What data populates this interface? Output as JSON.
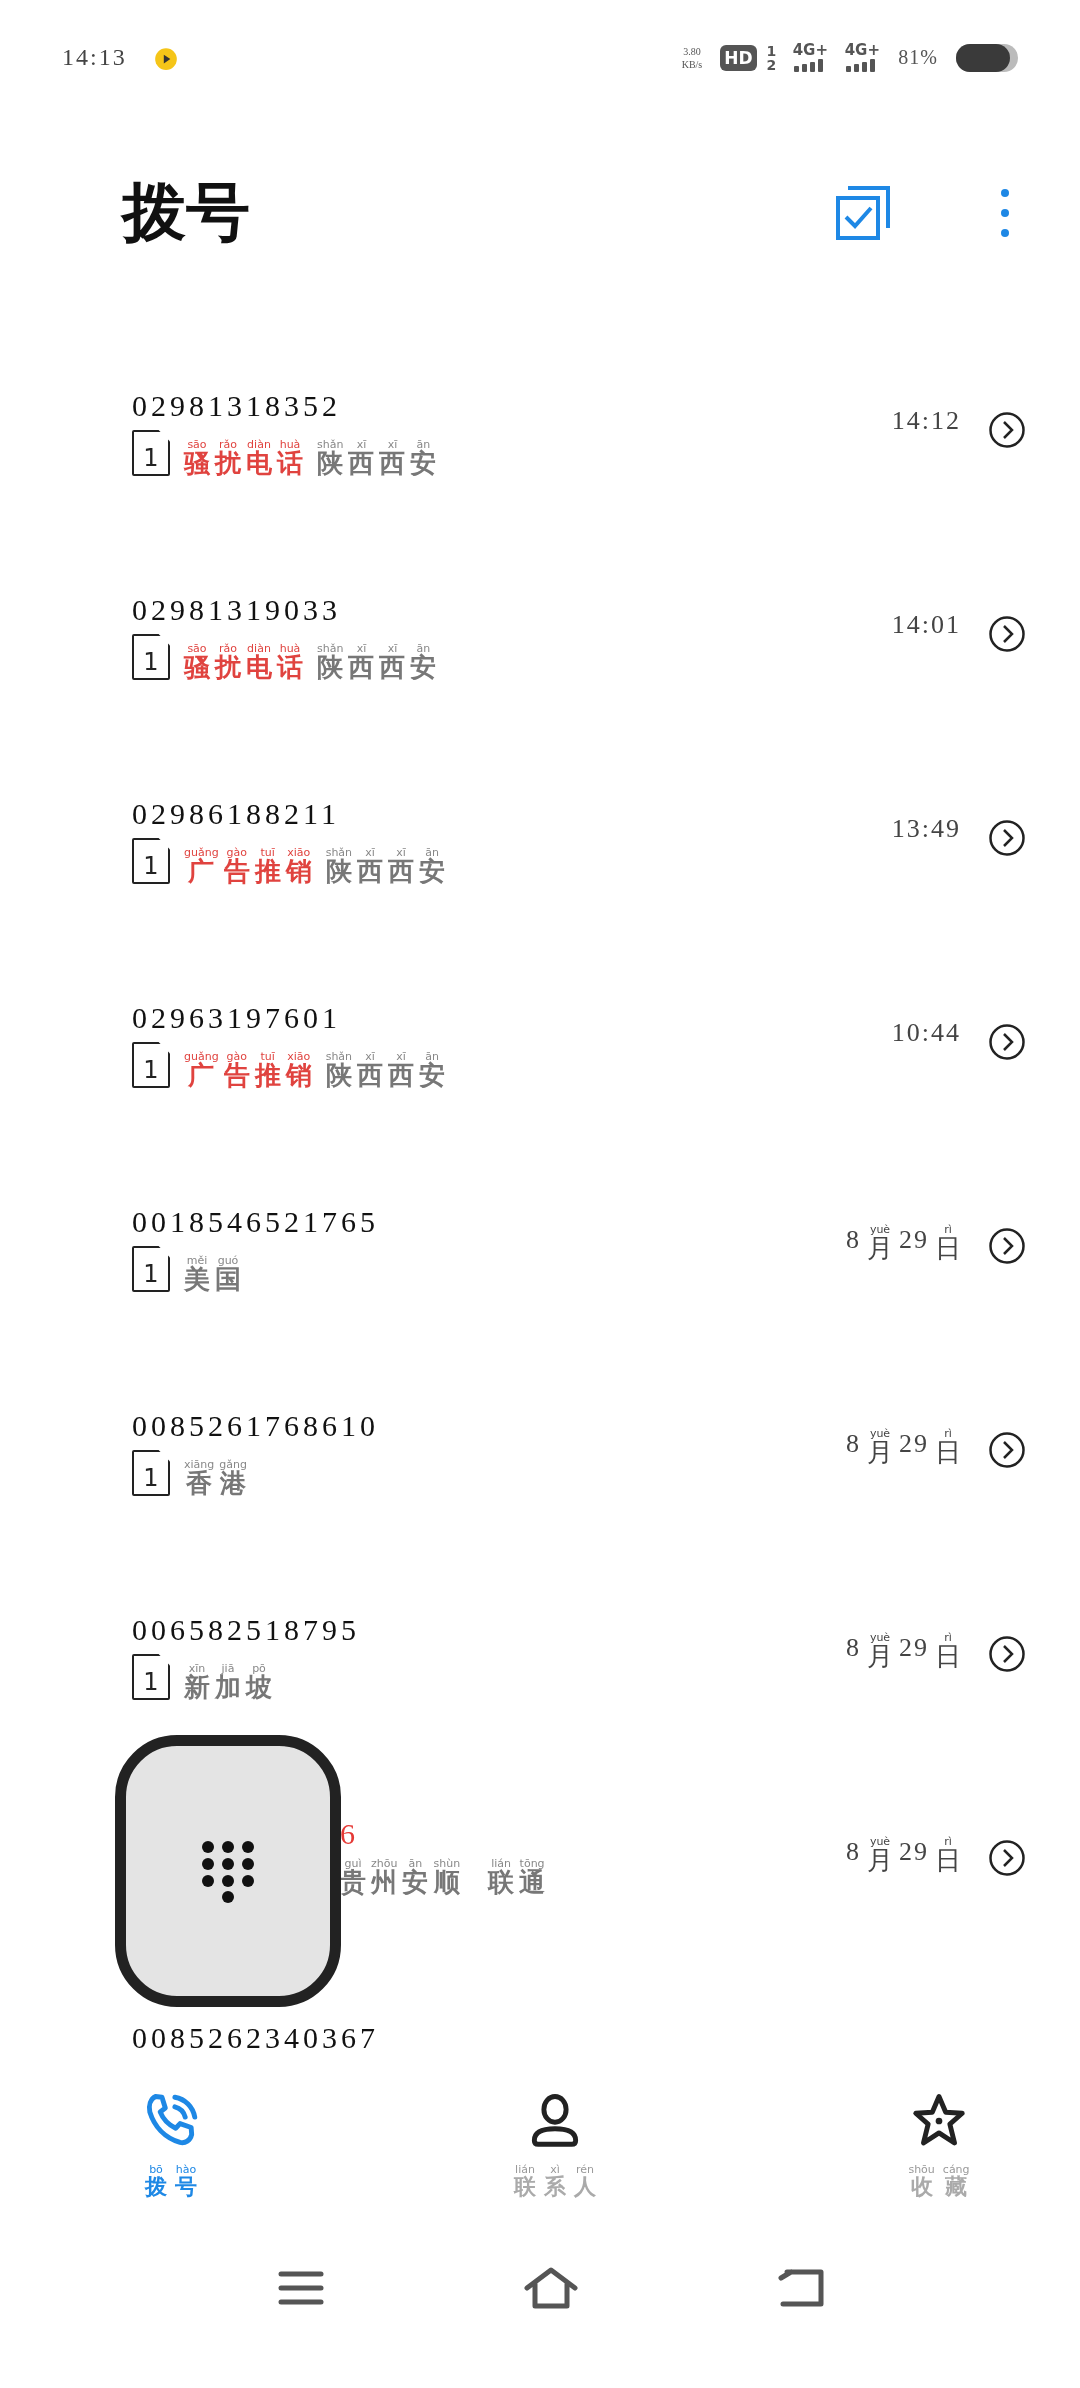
{
  "status_bar": {
    "time": "14:13",
    "speed_value": "3.80",
    "speed_unit": "KB/s",
    "hd": "HD",
    "sim_slots": [
      "1",
      "2"
    ],
    "networks": [
      "4G+",
      "4G+"
    ],
    "battery": "81%"
  },
  "header": {
    "title": "拨号"
  },
  "calls": [
    {
      "number": "02981318352",
      "missed": false,
      "covered": false,
      "sim": "1",
      "tag": [
        {
          "t": "骚",
          "py": "sāo"
        },
        {
          "t": "扰",
          "py": "rǎo"
        },
        {
          "t": "电",
          "py": "diàn"
        },
        {
          "t": "话",
          "py": "huà"
        }
      ],
      "location": [
        {
          "t": "陕",
          "py": "shǎn"
        },
        {
          "t": "西",
          "py": "xī"
        },
        {
          "t": "西",
          "py": "xī"
        },
        {
          "t": "安",
          "py": "ān"
        }
      ],
      "time": [
        {
          "t": "14:12"
        }
      ]
    },
    {
      "number": "02981319033",
      "missed": false,
      "covered": false,
      "sim": "1",
      "tag": [
        {
          "t": "骚",
          "py": "sāo"
        },
        {
          "t": "扰",
          "py": "rǎo"
        },
        {
          "t": "电",
          "py": "diàn"
        },
        {
          "t": "话",
          "py": "huà"
        }
      ],
      "location": [
        {
          "t": "陕",
          "py": "shǎn"
        },
        {
          "t": "西",
          "py": "xī"
        },
        {
          "t": "西",
          "py": "xī"
        },
        {
          "t": "安",
          "py": "ān"
        }
      ],
      "time": [
        {
          "t": "14:01"
        }
      ]
    },
    {
      "number": "02986188211",
      "missed": false,
      "covered": false,
      "sim": "1",
      "tag": [
        {
          "t": "广",
          "py": "guǎng"
        },
        {
          "t": "告",
          "py": "gào"
        },
        {
          "t": "推",
          "py": "tuī"
        },
        {
          "t": "销",
          "py": "xiāo"
        }
      ],
      "location": [
        {
          "t": "陕",
          "py": "shǎn"
        },
        {
          "t": "西",
          "py": "xī"
        },
        {
          "t": "西",
          "py": "xī"
        },
        {
          "t": "安",
          "py": "ān"
        }
      ],
      "time": [
        {
          "t": "13:49"
        }
      ]
    },
    {
      "number": "02963197601",
      "missed": false,
      "covered": false,
      "sim": "1",
      "tag": [
        {
          "t": "广",
          "py": "guǎng"
        },
        {
          "t": "告",
          "py": "gào"
        },
        {
          "t": "推",
          "py": "tuī"
        },
        {
          "t": "销",
          "py": "xiāo"
        }
      ],
      "location": [
        {
          "t": "陕",
          "py": "shǎn"
        },
        {
          "t": "西",
          "py": "xī"
        },
        {
          "t": "西",
          "py": "xī"
        },
        {
          "t": "安",
          "py": "ān"
        }
      ],
      "time": [
        {
          "t": "10:44"
        }
      ]
    },
    {
      "number": "0018546521765",
      "missed": false,
      "covered": false,
      "sim": "1",
      "location": [
        {
          "t": "美",
          "py": "měi"
        },
        {
          "t": "国",
          "py": "guó"
        }
      ],
      "time": [
        {
          "t": "8"
        },
        {
          "t": "月",
          "py": "yuè"
        },
        {
          "t": "29"
        },
        {
          "t": "日",
          "py": "rì"
        }
      ]
    },
    {
      "number": "0085261768610",
      "missed": false,
      "covered": false,
      "sim": "1",
      "location": [
        {
          "t": "香",
          "py": "xiāng"
        },
        {
          "t": "港",
          "py": "gǎng"
        }
      ],
      "time": [
        {
          "t": "8"
        },
        {
          "t": "月",
          "py": "yuè"
        },
        {
          "t": "29"
        },
        {
          "t": "日",
          "py": "rì"
        }
      ]
    },
    {
      "number": "006582518795",
      "missed": false,
      "covered": false,
      "sim": "1",
      "location": [
        {
          "t": "新",
          "py": "xīn"
        },
        {
          "t": "加",
          "py": "jiā"
        },
        {
          "t": "坡",
          "py": "pō"
        }
      ],
      "time": [
        {
          "t": "8"
        },
        {
          "t": "月",
          "py": "yuè"
        },
        {
          "t": "29"
        },
        {
          "t": "日",
          "py": "rì"
        }
      ]
    },
    {
      "number": "6",
      "missed": true,
      "covered": true,
      "location": [
        {
          "t": "贵",
          "py": "guì"
        },
        {
          "t": "州",
          "py": "zhōu"
        },
        {
          "t": "安",
          "py": "ān"
        },
        {
          "t": "顺",
          "py": "shùn"
        }
      ],
      "carrier": [
        {
          "t": "联",
          "py": "lián"
        },
        {
          "t": "通",
          "py": "tōng"
        }
      ],
      "time": [
        {
          "t": "8"
        },
        {
          "t": "月",
          "py": "yuè"
        },
        {
          "t": "29"
        },
        {
          "t": "日",
          "py": "rì"
        }
      ]
    },
    {
      "number": "0085262340367",
      "missed": false,
      "covered": false
    }
  ],
  "nav": [
    {
      "kind": "phone",
      "label": [
        {
          "t": "拨",
          "py": "bō"
        },
        {
          "t": "号",
          "py": "hào"
        }
      ],
      "selected": true
    },
    {
      "kind": "person",
      "label": [
        {
          "t": "联",
          "py": "lián"
        },
        {
          "t": "系",
          "py": "xì"
        },
        {
          "t": "人",
          "py": "rén"
        }
      ],
      "selected": false
    },
    {
      "kind": "star",
      "label": [
        {
          "t": "收",
          "py": "shōu"
        },
        {
          "t": "藏",
          "py": "cáng"
        }
      ],
      "selected": false
    }
  ]
}
